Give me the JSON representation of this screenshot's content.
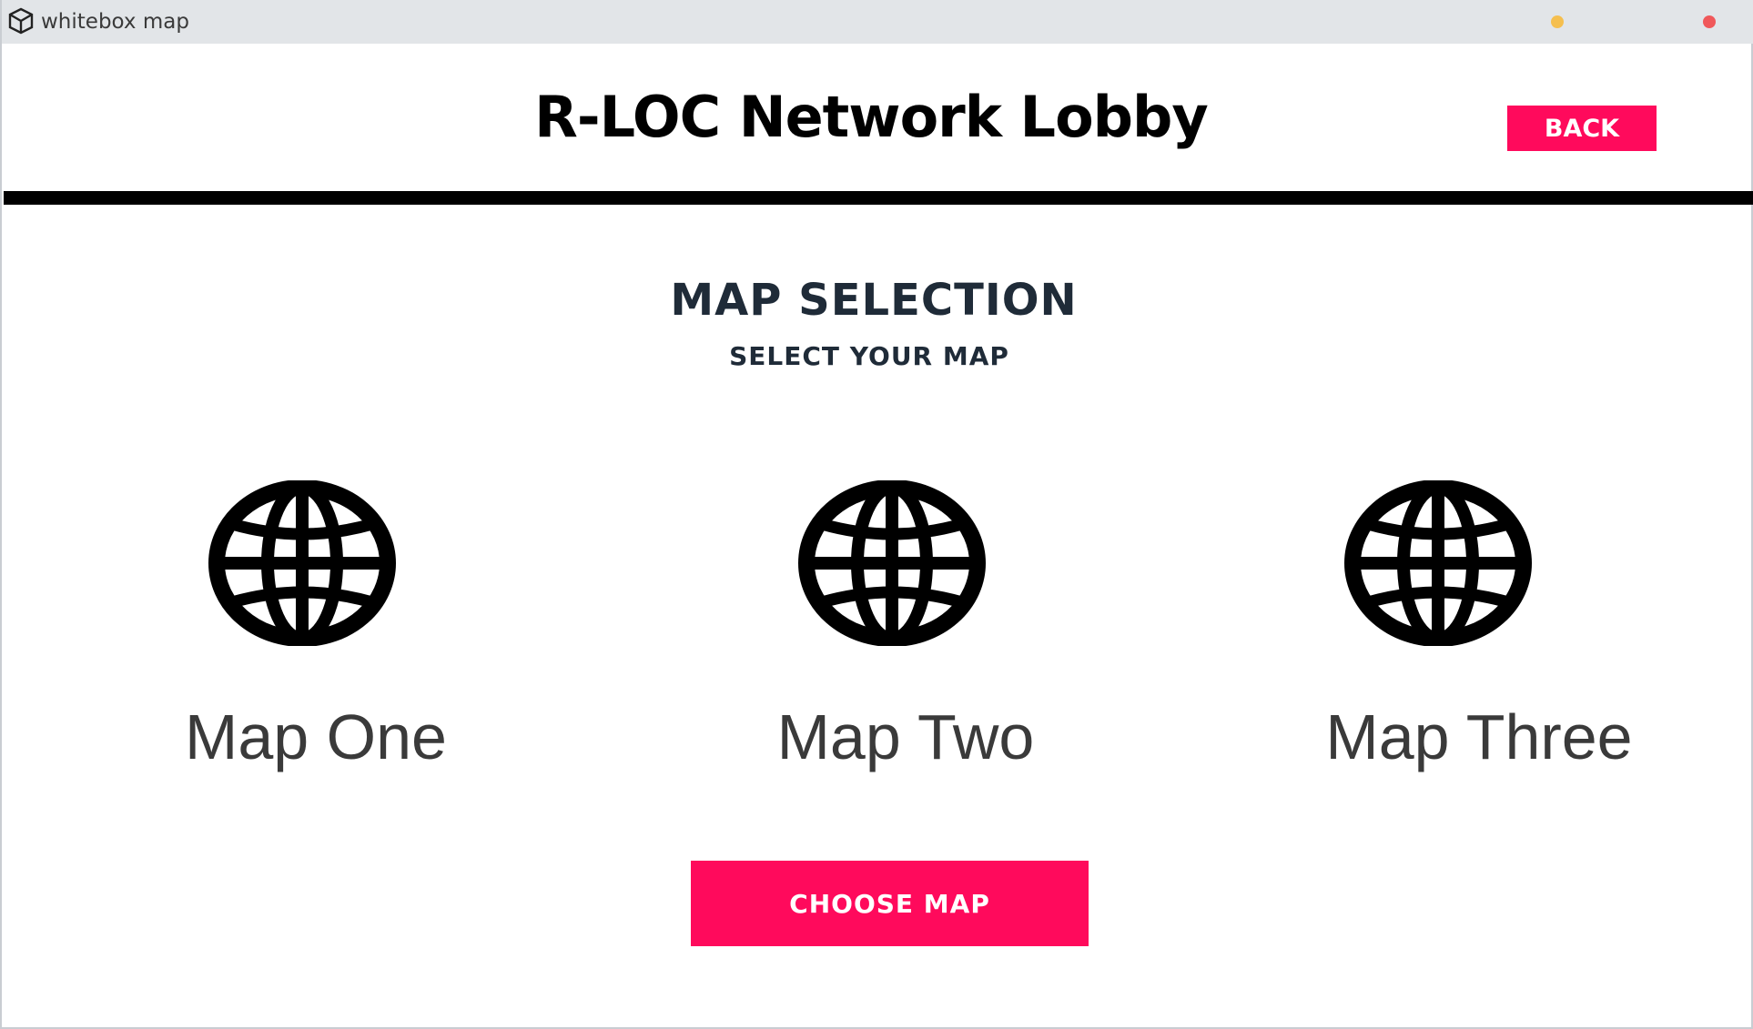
{
  "window": {
    "title": "whitebox map",
    "app_icon": "unity-logo-icon"
  },
  "header": {
    "title": "R-LOC Network Lobby",
    "back_label": "BACK"
  },
  "map_selection": {
    "title": "MAP SELECTION",
    "subtitle": "SELECT YOUR MAP",
    "maps": [
      {
        "label": "Map One",
        "icon": "globe-icon"
      },
      {
        "label": "Map Two",
        "icon": "globe-icon"
      },
      {
        "label": "Map Three",
        "icon": "globe-icon"
      }
    ],
    "choose_label": "CHOOSE MAP"
  },
  "colors": {
    "accent": "#ff0a5c",
    "heading": "#1f2b38",
    "titlebar": "#e2e5e8",
    "minimize": "#f5bf4f",
    "close": "#f0585a"
  }
}
